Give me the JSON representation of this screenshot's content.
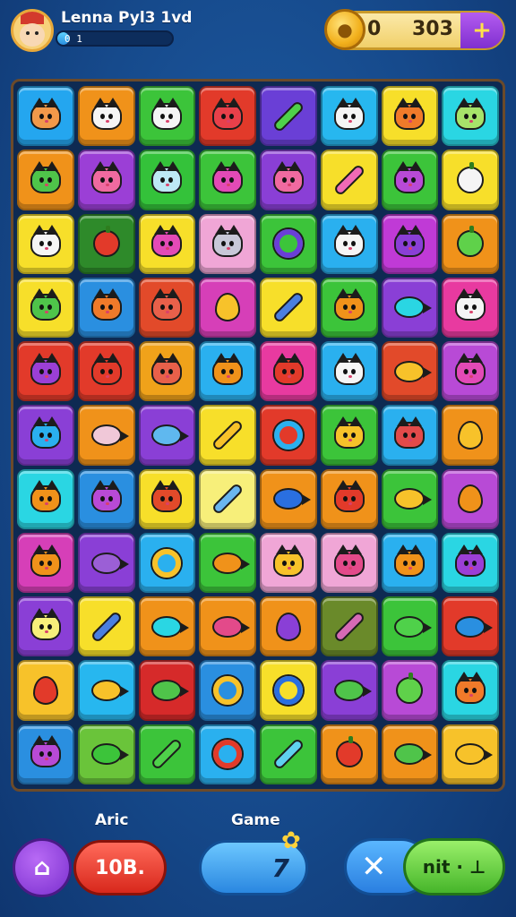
{
  "header": {
    "player_name": "Lenna Pyl3 1vd",
    "xp_text": "0 1",
    "xp_progress": 0.1,
    "coin_left": "0",
    "coin_value": "303",
    "add_coin_label": "+"
  },
  "board": {
    "rows": 11,
    "cols": 8,
    "tiles": [
      [
        "#24a6ef",
        "cat",
        "#f2994a"
      ],
      [
        "#f0921a",
        "cat",
        "#f5f5f5"
      ],
      [
        "#3cc43a",
        "cat",
        "#f5f5f5"
      ],
      [
        "#e23a2a",
        "cat",
        "#e8404a"
      ],
      [
        "#6a3fd6",
        "stick",
        "#4fd14a"
      ],
      [
        "#27b7ef",
        "cat",
        "#f5f5f5"
      ],
      [
        "#f7df2a",
        "cat",
        "#f07a2a"
      ],
      [
        "#2ad6e3",
        "cat",
        "#a6e36a"
      ],
      [
        "#f0921a",
        "cat",
        "#4fc44a"
      ],
      [
        "#9b3fd6",
        "cat",
        "#f06aa0"
      ],
      [
        "#34c23a",
        "cat",
        "#bde9f5"
      ],
      [
        "#3cc43a",
        "cat",
        "#e34ab6"
      ],
      [
        "#8a3fd6",
        "cat",
        "#f06aa0"
      ],
      [
        "#f7df2a",
        "stick",
        "#f06ab6"
      ],
      [
        "#3cc43a",
        "cat",
        "#b84ad6"
      ],
      [
        "#f7df2a",
        "fruit",
        "#f5f5f5"
      ],
      [
        "#f7df2a",
        "cat",
        "#f5f5f5"
      ],
      [
        "#2e8a2a",
        "fruit",
        "#e23a2a"
      ],
      [
        "#f7df2a",
        "cat",
        "#e34ab6"
      ],
      [
        "#f0a6d6",
        "cat",
        "#c8c8d8"
      ],
      [
        "#3cc43a",
        "ring",
        "#6a3fd6"
      ],
      [
        "#2ab0ef",
        "cat",
        "#f5f5f5"
      ],
      [
        "#c03ad6",
        "cat",
        "#8a3fd6"
      ],
      [
        "#f0921a",
        "fruit",
        "#5fd14a"
      ],
      [
        "#f7df2a",
        "cat",
        "#4fc44a"
      ],
      [
        "#2a8fe0",
        "cat",
        "#f07a2a"
      ],
      [
        "#e24a2a",
        "cat",
        "#e8604a"
      ],
      [
        "#d63fb8",
        "drop",
        "#f7c22a"
      ],
      [
        "#f7df2a",
        "stick",
        "#4a7fe0"
      ],
      [
        "#3cc43a",
        "cat",
        "#f0921a"
      ],
      [
        "#8a3fd6",
        "fish",
        "#2ad6e3"
      ],
      [
        "#e83aa0",
        "cat",
        "#f5f5f5"
      ],
      [
        "#e23a2a",
        "cat",
        "#9b3fd6"
      ],
      [
        "#e23a2a",
        "cat",
        "#e23a2a"
      ],
      [
        "#f0a21a",
        "cat",
        "#e8604a"
      ],
      [
        "#2ab0ef",
        "cat",
        "#f0921a"
      ],
      [
        "#e83aa0",
        "cat",
        "#e23a2a"
      ],
      [
        "#2ab0ef",
        "cat",
        "#f5f5f5"
      ],
      [
        "#e24a2a",
        "fish",
        "#f7c22a"
      ],
      [
        "#b84ad6",
        "cat",
        "#e34ab6"
      ],
      [
        "#8a3fd6",
        "cat",
        "#2ab0ef"
      ],
      [
        "#f0921a",
        "fish",
        "#f0c8d8"
      ],
      [
        "#8a3fd6",
        "fish",
        "#5fb8ef"
      ],
      [
        "#f7df2a",
        "stick",
        "#f7c22a"
      ],
      [
        "#e23a2a",
        "ring",
        "#2ab0ef"
      ],
      [
        "#3cc43a",
        "cat",
        "#f7c22a"
      ],
      [
        "#2ab0ef",
        "cat",
        "#e24a4a"
      ],
      [
        "#f0921a",
        "drop",
        "#f7c22a"
      ],
      [
        "#2ad6e3",
        "cat",
        "#f0921a"
      ],
      [
        "#2a8fe0",
        "cat",
        "#b84ad6"
      ],
      [
        "#f7df2a",
        "cat",
        "#e24a2a"
      ],
      [
        "#f7ef7a",
        "stick",
        "#6ab6ef"
      ],
      [
        "#f0921a",
        "fish",
        "#2a6fe0"
      ],
      [
        "#f0921a",
        "cat",
        "#e23a2a"
      ],
      [
        "#3cc43a",
        "fish",
        "#f7c22a"
      ],
      [
        "#b84ad6",
        "drop",
        "#f0921a"
      ],
      [
        "#d63fb8",
        "cat",
        "#f0921a"
      ],
      [
        "#8a3fd6",
        "fish",
        "#9b5fd6"
      ],
      [
        "#2ab0ef",
        "ring",
        "#f7c22a"
      ],
      [
        "#3cc43a",
        "fish",
        "#f0921a"
      ],
      [
        "#f0a6d6",
        "cat",
        "#f7c22a"
      ],
      [
        "#f0a6d6",
        "cat",
        "#e34a8a"
      ],
      [
        "#2ab0ef",
        "cat",
        "#f0921a"
      ],
      [
        "#2ad6e3",
        "cat",
        "#9b3fd6"
      ],
      [
        "#8a3fd6",
        "cat",
        "#f7ef7a"
      ],
      [
        "#f7df2a",
        "stick",
        "#4a7fe0"
      ],
      [
        "#f0921a",
        "fish",
        "#2ad6e3"
      ],
      [
        "#f0921a",
        "fish",
        "#e34a8a"
      ],
      [
        "#f0921a",
        "drop",
        "#8a3fd6"
      ],
      [
        "#6a8a2a",
        "stick",
        "#d66ab6"
      ],
      [
        "#3cc43a",
        "fish",
        "#4fd14a"
      ],
      [
        "#e23a2a",
        "fish",
        "#2a8fe0"
      ],
      [
        "#f7c22a",
        "drop",
        "#e23a2a"
      ],
      [
        "#27b7ef",
        "fish",
        "#f7c22a"
      ],
      [
        "#d62a2a",
        "fish",
        "#4fc44a"
      ],
      [
        "#2a8fe0",
        "ring",
        "#f7c22a"
      ],
      [
        "#f7df2a",
        "ring",
        "#2a6fe0"
      ],
      [
        "#8a3fd6",
        "fish",
        "#4fc44a"
      ],
      [
        "#b84ad6",
        "fruit",
        "#5fd14a"
      ],
      [
        "#2ad6e3",
        "cat",
        "#f07a2a"
      ],
      [
        "#2a8fe0",
        "cat",
        "#b84ad6"
      ],
      [
        "#6ac43a",
        "fish",
        "#3cc43a"
      ],
      [
        "#3cc43a",
        "stick",
        "#4fd14a"
      ],
      [
        "#2ab0ef",
        "ring",
        "#e23a2a"
      ],
      [
        "#3cc43a",
        "stick",
        "#5fd1f0"
      ],
      [
        "#f0921a",
        "fruit",
        "#e23a2a"
      ],
      [
        "#f0921a",
        "fish",
        "#4fc44a"
      ],
      [
        "#f7c22a",
        "fish",
        "#f7c22a"
      ]
    ]
  },
  "hud": {
    "left_label": "Aric",
    "center_label": "Game",
    "left_button_icon": "house-icon",
    "left_button_glyph": "⌂",
    "red_value": "10B.",
    "blue_value": "7",
    "star_glyph": "✿",
    "close_glyph": "✕",
    "green_label": "nit · ⊥"
  }
}
